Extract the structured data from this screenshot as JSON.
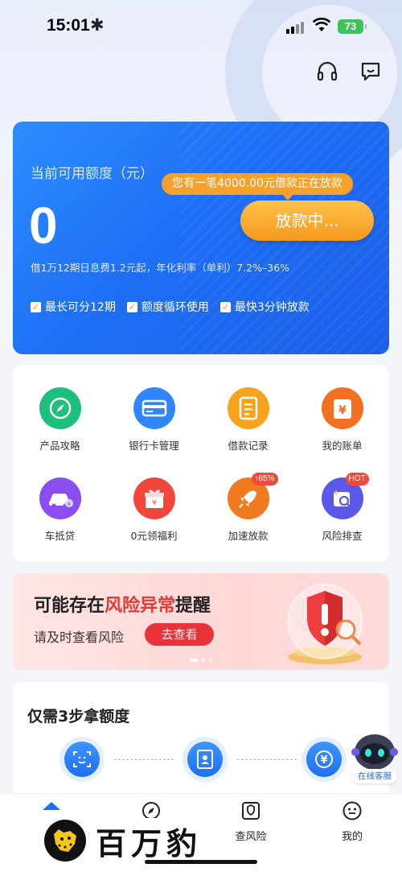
{
  "status_bar": {
    "time": "15:01",
    "extra_glyph": "✱",
    "battery": "73"
  },
  "header": {
    "left_icon": "headset-icon",
    "right_icon": "message-icon"
  },
  "credit_card": {
    "label": "当前可用额度（元）",
    "amount": "0",
    "loan_notice": "您有一笔4000.00元借款正在放款",
    "disburse_button": "放款中...",
    "rate_text": "借1万12期日息费1.2元起，年化利率（单利）7.2%–36%",
    "features": [
      "最长可分12期",
      "额度循环使用",
      "最快3分钟放款"
    ],
    "check_glyph": "✓"
  },
  "services": [
    {
      "label": "产品攻略",
      "icon": "compass-icon",
      "color": "#1dbf7c"
    },
    {
      "label": "银行卡管理",
      "icon": "bank-card-icon",
      "color": "#2f86ff"
    },
    {
      "label": "借款记录",
      "icon": "document-icon",
      "color": "#f8a21d"
    },
    {
      "label": "我的账单",
      "icon": "bill-icon",
      "color": "#f37021"
    },
    {
      "label": "车抵贷",
      "icon": "car-icon",
      "color": "#8c4df0"
    },
    {
      "label": "0元领福利",
      "icon": "gift-icon",
      "color": "#f0473a"
    },
    {
      "label": "加速放款",
      "icon": "rocket-icon",
      "color": "#f07a1d",
      "badge": "↑85%"
    },
    {
      "label": "风险排查",
      "icon": "risk-search-icon",
      "color": "#5a57ea",
      "badge": "HOT"
    }
  ],
  "risk_banner": {
    "title_prefix": "可能存在",
    "title_highlight": "风险异常",
    "title_suffix": "提醒",
    "subtitle": "请及时查看风险",
    "button": "去查看"
  },
  "steps": {
    "title": "仅需3步拿额度"
  },
  "floating_cs": {
    "label": "在线客服"
  },
  "tab_bar": {
    "tabs": [
      {
        "label": "",
        "icon": "home-icon"
      },
      {
        "label": "",
        "icon": "compass-icon"
      },
      {
        "label": "查风险",
        "icon": "shield-check-icon"
      },
      {
        "label": "我的",
        "icon": "profile-icon"
      }
    ]
  },
  "brand": {
    "name": "百万豹"
  }
}
